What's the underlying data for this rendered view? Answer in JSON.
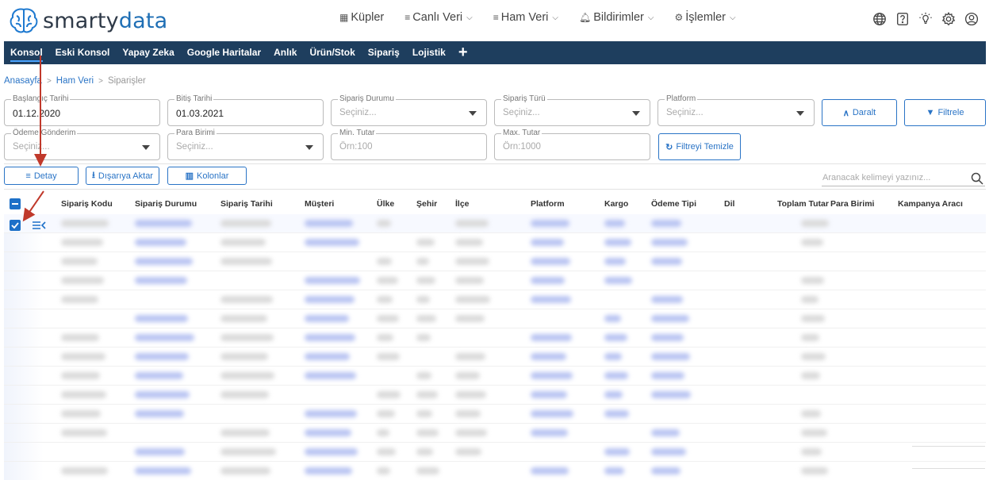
{
  "header": {
    "logo_text_a": "smarty",
    "logo_text_b": "data",
    "nav": [
      {
        "label": "Küpler",
        "icon": "cubes-icon",
        "has_dropdown": false
      },
      {
        "label": "Canlı Veri",
        "icon": "list-icon",
        "has_dropdown": true
      },
      {
        "label": "Ham Veri",
        "icon": "list-icon",
        "has_dropdown": true
      },
      {
        "label": "Bildirimler",
        "icon": "bell-icon",
        "has_dropdown": true
      },
      {
        "label": "İşlemler",
        "icon": "users-cog-icon",
        "has_dropdown": true
      }
    ],
    "icons": [
      "globe-icon",
      "help-icon",
      "lightbulb-icon",
      "gear-icon",
      "user-circle-icon"
    ]
  },
  "navbar": {
    "items": [
      "Konsol",
      "Eski Konsol",
      "Yapay Zeka",
      "Google Haritalar",
      "Anlık",
      "Ürün/Stok",
      "Sipariş",
      "Lojistik"
    ],
    "active_index": 0,
    "add_label": "+"
  },
  "breadcrumb": {
    "items": [
      "Anasayfa",
      "Ham Veri"
    ],
    "current": "Siparişler",
    "separator": ">"
  },
  "filters": {
    "start_date": {
      "label": "Başlangıç Tarihi",
      "value": "01.12.2020"
    },
    "end_date": {
      "label": "Bitiş Tarihi",
      "value": "01.03.2021"
    },
    "order_status": {
      "label": "Sipariş Durumu",
      "placeholder": "Seçiniz..."
    },
    "order_type": {
      "label": "Sipariş Türü",
      "placeholder": "Seçiniz..."
    },
    "platform": {
      "label": "Platform",
      "placeholder": "Seçiniz..."
    },
    "payment_method": {
      "label": "Ödeme Gönderim",
      "placeholder": "Seçiniz..."
    },
    "currency": {
      "label": "Para Birimi",
      "placeholder": "Seçiniz..."
    },
    "min_amount": {
      "label": "Min. Tutar",
      "placeholder": "Örn:100"
    },
    "max_amount": {
      "label": "Max. Tutar",
      "placeholder": "Örn:1000"
    },
    "collapse_label": "Daralt",
    "filter_label": "Filtrele",
    "clear_label": "Filtreyi Temizle"
  },
  "toolbar": {
    "detail_label": "Detay",
    "export_label": "Dışarıya Aktar",
    "columns_label": "Kolonlar",
    "search_placeholder": "Aranacak kelimeyi yazınız..."
  },
  "table": {
    "columns": [
      "Sipariş Kodu",
      "Sipariş Durumu",
      "Sipariş Tarihi",
      "Müşteri",
      "Ülke",
      "Şehir",
      "İlçe",
      "Platform",
      "Kargo",
      "Ödeme Tipi",
      "Dil",
      "Toplam Tutar",
      "Para Birimi",
      "Kampanya Aracı"
    ],
    "row_count_visible": 14,
    "first_row_selected": true
  },
  "colors": {
    "navbar_bg": "#1e3e5e",
    "accent": "#2a74c6",
    "checkbox": "#1d70c8",
    "annotation_arrow": "#c0392b"
  }
}
